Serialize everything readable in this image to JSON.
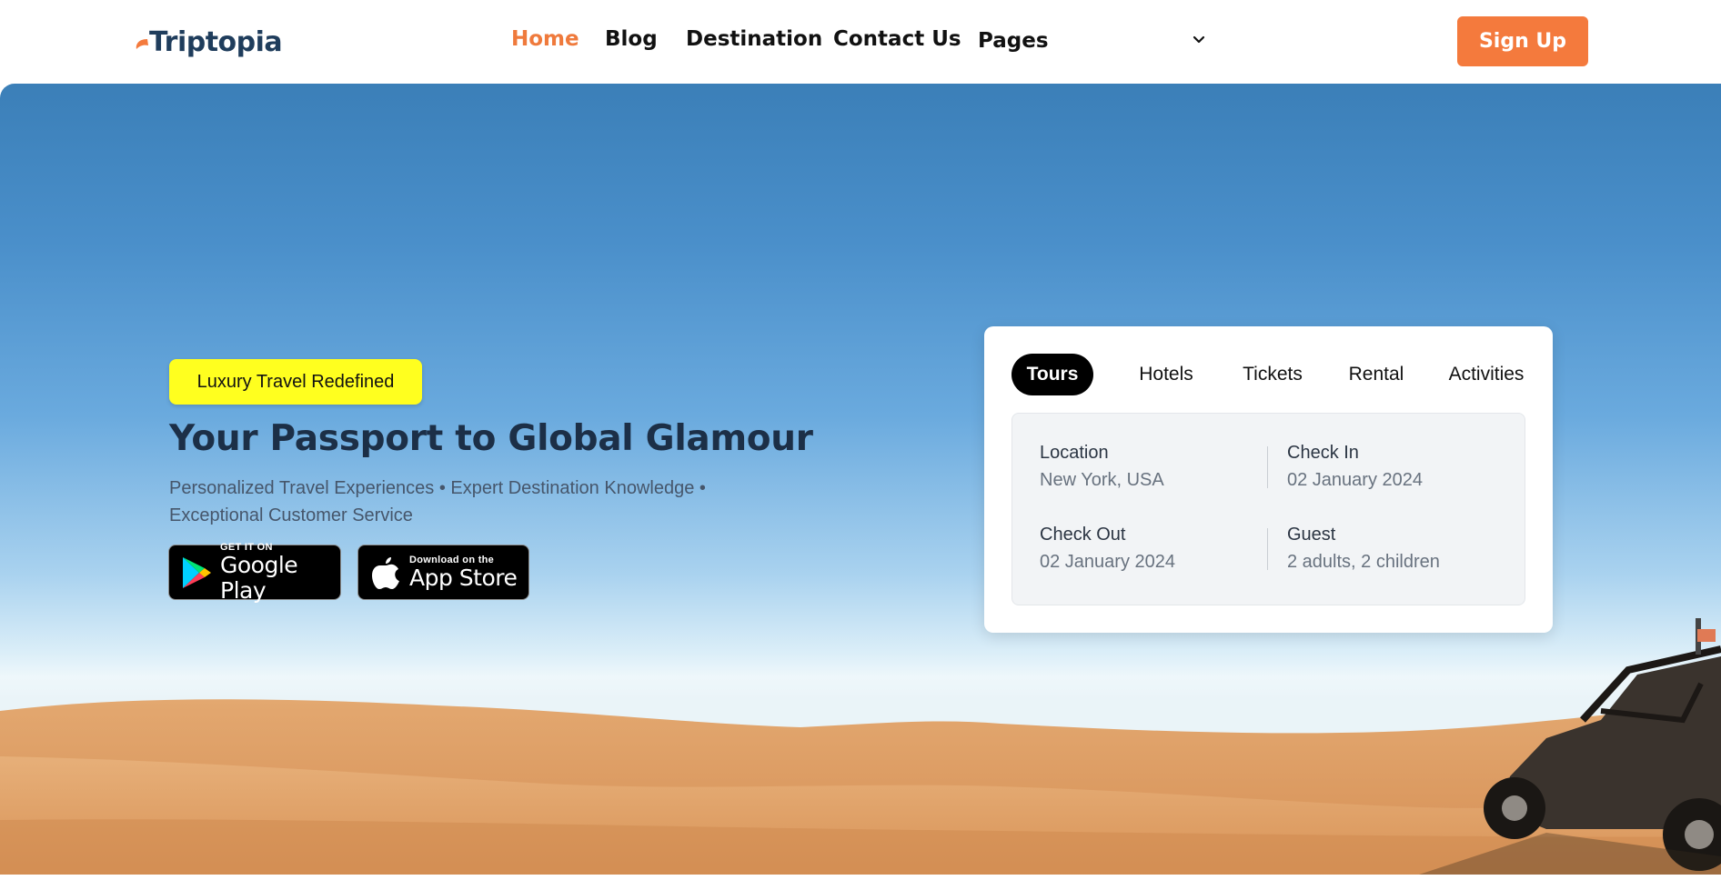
{
  "header": {
    "logo_text": "Triptopia",
    "nav": [
      {
        "label": "Home",
        "active": true
      },
      {
        "label": "Blog",
        "active": false
      },
      {
        "label": "Destination",
        "active": false
      },
      {
        "label": "Contact Us",
        "active": false
      },
      {
        "label": "Pages",
        "active": false
      }
    ],
    "pages_dropdown_icon": "chevron-down-icon",
    "signup_label": "Sign Up"
  },
  "hero": {
    "badge": "Luxury Travel Redefined",
    "title": "Your Passport to Global Glamour",
    "subtitle": "Personalized Travel Experiences • Expert Destination Knowledge • Exceptional Customer Service",
    "google_play": {
      "small": "GET IT ON",
      "big": "Google Play"
    },
    "app_store": {
      "small": "Download on the",
      "big": "App Store"
    }
  },
  "search": {
    "tabs": [
      {
        "label": "Tours",
        "active": true
      },
      {
        "label": "Hotels",
        "active": false
      },
      {
        "label": "Tickets",
        "active": false
      },
      {
        "label": "Rental",
        "active": false
      },
      {
        "label": "Activities",
        "active": false
      }
    ],
    "fields": {
      "location": {
        "label": "Location",
        "value": "New York, USA"
      },
      "check_in": {
        "label": "Check In",
        "value": "02 January 2024"
      },
      "check_out": {
        "label": "Check Out",
        "value": "02 January 2024"
      },
      "guest": {
        "label": "Guest",
        "value": "2 adults, 2 children"
      }
    }
  },
  "colors": {
    "accent": "#f47a3d",
    "badge": "#ffff1f",
    "title": "#1c2f47"
  }
}
